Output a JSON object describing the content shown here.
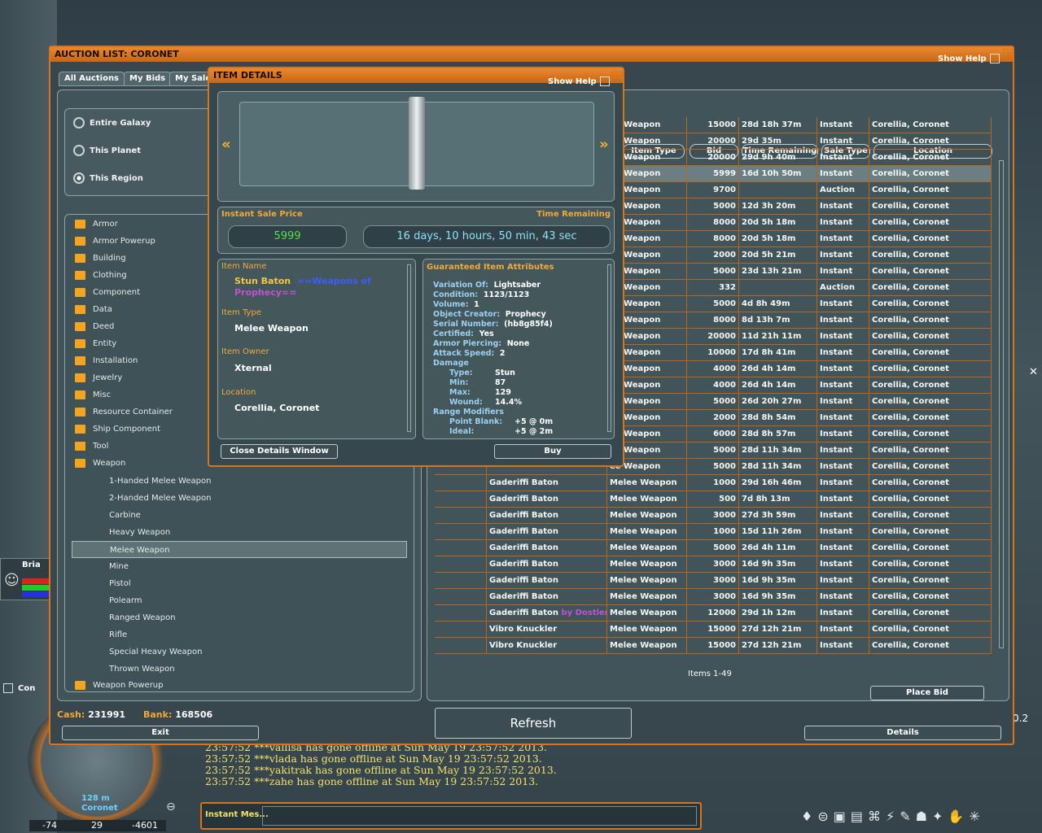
{
  "auction": {
    "title": "AUCTION LIST: CORONET",
    "show_help": "Show Help",
    "tabs": [
      "All Auctions",
      "My Bids",
      "My Sales"
    ],
    "scope": [
      "Entire Galaxy",
      "This Planet",
      "This Region"
    ],
    "categories": [
      "Armor",
      "Armor Powerup",
      "Building",
      "Clothing",
      "Component",
      "Data",
      "Deed",
      "Entity",
      "Installation",
      "Jewelry",
      "Misc",
      "Resource Container",
      "Ship Component",
      "Tool",
      "Weapon"
    ],
    "weapon_sub": [
      "1-Handed Melee Weapon",
      "2-Handed Melee Weapon",
      "Carbine",
      "Heavy Weapon",
      "Melee Weapon",
      "Mine",
      "Pistol",
      "Polearm",
      "Ranged Weapon",
      "Rifle",
      "Special Heavy Weapon",
      "Thrown Weapon"
    ],
    "cat_last": "Weapon Powerup",
    "columns": [
      "Item Type",
      "Bid",
      "Time Remaining",
      "Sale Type",
      "Location"
    ],
    "rows": [
      {
        "name": "",
        "type": "ee Weapon",
        "bid": "15000",
        "time": "28d 18h 37m",
        "sale": "Instant",
        "loc": "Corellia, Coronet"
      },
      {
        "name": "",
        "type": "ee Weapon",
        "bid": "20000",
        "time": "29d 35m",
        "sale": "Instant",
        "loc": "Corellia, Coronet"
      },
      {
        "name": "",
        "type": "ee Weapon",
        "bid": "20000",
        "time": "29d 9h 40m",
        "sale": "Instant",
        "loc": "Corellia, Coronet"
      },
      {
        "name": "",
        "type": "ee Weapon",
        "bid": "5999",
        "time": "16d 10h 50m",
        "sale": "Instant",
        "loc": "Corellia, Coronet"
      },
      {
        "name": "",
        "type": "ee Weapon",
        "bid": "9700",
        "time": "",
        "sale": "Auction",
        "loc": "Corellia, Coronet"
      },
      {
        "name": "",
        "type": "ee Weapon",
        "bid": "5000",
        "time": "12d 3h 20m",
        "sale": "Instant",
        "loc": "Corellia, Coronet"
      },
      {
        "name": "",
        "type": "ee Weapon",
        "bid": "8000",
        "time": "20d 5h 18m",
        "sale": "Instant",
        "loc": "Corellia, Coronet"
      },
      {
        "name": "",
        "type": "ee Weapon",
        "bid": "8000",
        "time": "20d 5h 18m",
        "sale": "Instant",
        "loc": "Corellia, Coronet"
      },
      {
        "name": "",
        "type": "ee Weapon",
        "bid": "2000",
        "time": "20d 5h 21m",
        "sale": "Instant",
        "loc": "Corellia, Coronet"
      },
      {
        "name": "",
        "type": "ee Weapon",
        "bid": "5000",
        "time": "23d 13h 21m",
        "sale": "Instant",
        "loc": "Corellia, Coronet"
      },
      {
        "name": "",
        "type": "ee Weapon",
        "bid": "332",
        "time": "",
        "sale": "Auction",
        "loc": "Corellia, Coronet"
      },
      {
        "name": "",
        "type": "ee Weapon",
        "bid": "5000",
        "time": "4d 8h 49m",
        "sale": "Instant",
        "loc": "Corellia, Coronet"
      },
      {
        "name": "",
        "type": "ee Weapon",
        "bid": "8000",
        "time": "8d 13h 7m",
        "sale": "Instant",
        "loc": "Corellia, Coronet"
      },
      {
        "name": "",
        "type": "ee Weapon",
        "bid": "20000",
        "time": "11d 21h 11m",
        "sale": "Instant",
        "loc": "Corellia, Coronet"
      },
      {
        "name": "",
        "type": "ee Weapon",
        "bid": "10000",
        "time": "17d 8h 41m",
        "sale": "Instant",
        "loc": "Corellia, Coronet"
      },
      {
        "name": "",
        "type": "ee Weapon",
        "bid": "4000",
        "time": "26d 4h 14m",
        "sale": "Instant",
        "loc": "Corellia, Coronet"
      },
      {
        "name": "",
        "type": "ee Weapon",
        "bid": "4000",
        "time": "26d 4h 14m",
        "sale": "Instant",
        "loc": "Corellia, Coronet"
      },
      {
        "name": "",
        "type": "ee Weapon",
        "bid": "5000",
        "time": "26d 20h 27m",
        "sale": "Instant",
        "loc": "Corellia, Coronet"
      },
      {
        "name": "",
        "type": "ee Weapon",
        "bid": "2000",
        "time": "28d 8h 54m",
        "sale": "Instant",
        "loc": "Corellia, Coronet"
      },
      {
        "name": "",
        "type": "ee Weapon",
        "bid": "6000",
        "time": "28d 8h 57m",
        "sale": "Instant",
        "loc": "Corellia, Coronet"
      },
      {
        "name": "",
        "type": "ee Weapon",
        "bid": "5000",
        "time": "28d 11h 34m",
        "sale": "Instant",
        "loc": "Corellia, Coronet"
      },
      {
        "name": "",
        "type": "ee Weapon",
        "bid": "5000",
        "time": "28d 11h 34m",
        "sale": "Instant",
        "loc": "Corellia, Coronet"
      },
      {
        "name": "Gaderiffi Baton",
        "type": "Melee Weapon",
        "bid": "1000",
        "time": "29d 16h 46m",
        "sale": "Instant",
        "loc": "Corellia, Coronet"
      },
      {
        "name": "Gaderiffi Baton",
        "type": "Melee Weapon",
        "bid": "500",
        "time": "7d 8h 13m",
        "sale": "Instant",
        "loc": "Corellia, Coronet"
      },
      {
        "name": "Gaderiffi Baton",
        "type": "Melee Weapon",
        "bid": "3000",
        "time": "27d 3h 59m",
        "sale": "Instant",
        "loc": "Corellia, Coronet"
      },
      {
        "name": "Gaderiffi Baton",
        "type": "Melee Weapon",
        "bid": "1000",
        "time": "15d 11h 26m",
        "sale": "Instant",
        "loc": "Corellia, Coronet"
      },
      {
        "name": "Gaderiffi Baton",
        "type": "Melee Weapon",
        "bid": "5000",
        "time": "26d 4h 11m",
        "sale": "Instant",
        "loc": "Corellia, Coronet"
      },
      {
        "name": "Gaderiffi Baton",
        "type": "Melee Weapon",
        "bid": "3000",
        "time": "16d 9h 35m",
        "sale": "Instant",
        "loc": "Corellia, Coronet"
      },
      {
        "name": "Gaderiffi Baton",
        "type": "Melee Weapon",
        "bid": "3000",
        "time": "16d 9h 35m",
        "sale": "Instant",
        "loc": "Corellia, Coronet"
      },
      {
        "name": "Gaderiffi Baton",
        "type": "Melee Weapon",
        "bid": "3000",
        "time": "16d 9h 35m",
        "sale": "Instant",
        "loc": "Corellia, Coronet"
      },
      {
        "name": "Gaderiffi Baton",
        "type": "Melee Weapon",
        "bid": "12000",
        "time": "29d 1h 12m",
        "sale": "Instant",
        "loc": "Corellia, Coronet"
      },
      {
        "name": "Vibro Knuckler",
        "type": "Melee Weapon",
        "bid": "15000",
        "time": "27d 12h 21m",
        "sale": "Instant",
        "loc": "Corellia, Coronet"
      },
      {
        "name": "Vibro Knuckler",
        "type": "Melee Weapon",
        "bid": "15000",
        "time": "27d 12h 21m",
        "sale": "Instant",
        "loc": "Corellia, Coronet"
      }
    ],
    "by_dostler": "by Dostler",
    "items_count": "Items 1-49",
    "place_bid": "Place Bid",
    "cash_label": "Cash:",
    "cash": "231991",
    "bank_label": "Bank:",
    "bank": "168506",
    "exit": "Exit",
    "refresh": "Refresh",
    "details": "Details"
  },
  "detail": {
    "title": "ITEM DETAILS",
    "show_help": "Show Help",
    "instant_label": "Instant Sale Price",
    "time_label": "Time Remaining",
    "price": "5999",
    "time": "16 days, 10 hours, 50 min, 43 sec",
    "name_label": "Item Name",
    "name_a": "Stun Baton",
    "name_b": "==Weapons of",
    "name_c": "Prophecy==",
    "type_label": "Item Type",
    "type": "Melee Weapon",
    "owner_label": "Item Owner",
    "owner": "Xternal",
    "loc_label": "Location",
    "loc": "Corellia, Coronet",
    "attr_title": "Guaranteed Item Attributes",
    "attrs": [
      {
        "k": "Variation Of:",
        "v": "Lightsaber"
      },
      {
        "k": "Condition:",
        "v": "1123/1123"
      },
      {
        "k": "Volume:",
        "v": "1"
      },
      {
        "k": "Object Creator:",
        "v": "Prophecy"
      },
      {
        "k": "Serial Number:",
        "v": "(hb8g85f4)"
      },
      {
        "k": "Certified:",
        "v": "Yes"
      },
      {
        "k": "Armor Piercing:",
        "v": "None"
      },
      {
        "k": "Attack Speed:",
        "v": "2"
      }
    ],
    "damage_label": "Damage",
    "damage": [
      {
        "k": "Type:",
        "v": "Stun"
      },
      {
        "k": "Min:",
        "v": "87"
      },
      {
        "k": "Max:",
        "v": "129"
      },
      {
        "k": "Wound:",
        "v": "14.4%"
      }
    ],
    "range_label": "Range Modifiers",
    "range": [
      {
        "k": "Point Blank:",
        "v": "+5 @ 0m"
      },
      {
        "k": "Ideal:",
        "v": "+5 @ 2m"
      }
    ],
    "close": "Close Details Window",
    "buy": "Buy"
  },
  "chat": {
    "lines": [
      "23:57:52 ***vallisa  has gone offline at Sun May 19 23:57:52 2013.",
      "23:57:52 ***vlada  has gone offline at Sun May 19 23:57:52 2013.",
      "23:57:52 ***yakitrak  has gone offline at Sun May 19 23:57:52 2013.",
      "23:57:52 ***zahe  has gone offline at Sun May 19 23:57:52 2013."
    ],
    "input_label": "Instant Mes..."
  },
  "hud": {
    "target_name": "Bria",
    "con": "Con",
    "distance": "128 m",
    "city": "Coronet",
    "coords": [
      "-74",
      "29",
      "-4601"
    ],
    "side_value": "0.2"
  }
}
